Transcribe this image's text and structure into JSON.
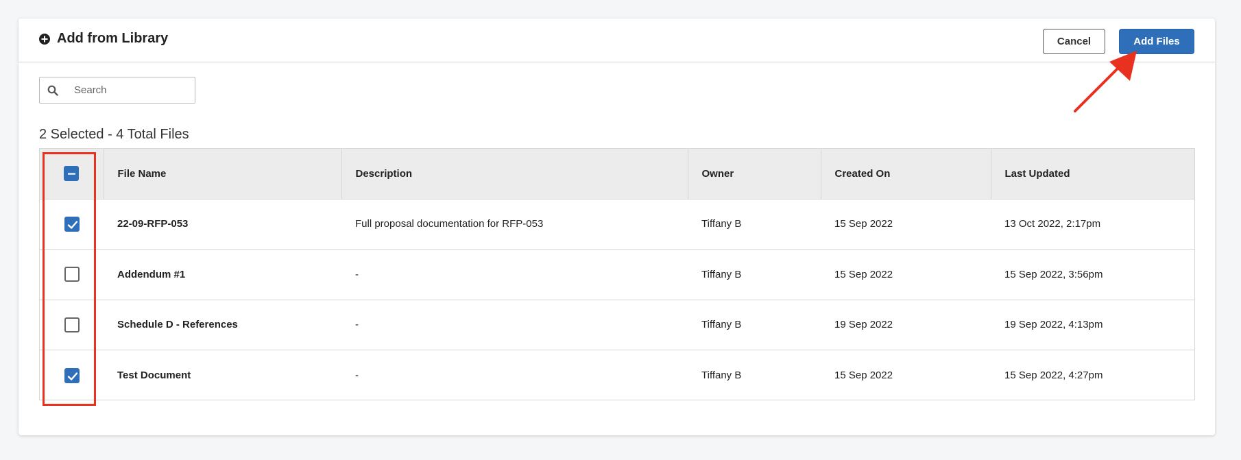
{
  "header": {
    "title": "Add from Library",
    "title_icon": "plus-circle-icon",
    "cancel_label": "Cancel",
    "add_label": "Add Files"
  },
  "search": {
    "placeholder": "Search",
    "value": ""
  },
  "summary": "2 Selected - 4 Total Files",
  "table": {
    "columns": [
      "File Name",
      "Description",
      "Owner",
      "Created On",
      "Last Updated"
    ],
    "select_all_state": "indeterminate",
    "rows": [
      {
        "checked": true,
        "file_name": "22-09-RFP-053",
        "description": "Full proposal documentation for RFP-053",
        "owner": "Tiffany B",
        "created_on": "15 Sep 2022",
        "last_updated": "13 Oct 2022, 2:17pm"
      },
      {
        "checked": false,
        "file_name": "Addendum #1",
        "description": "-",
        "owner": "Tiffany B",
        "created_on": "15 Sep 2022",
        "last_updated": "15 Sep 2022, 3:56pm"
      },
      {
        "checked": false,
        "file_name": "Schedule D - References",
        "description": "-",
        "owner": "Tiffany B",
        "created_on": "19 Sep 2022",
        "last_updated": "19 Sep 2022, 4:13pm"
      },
      {
        "checked": true,
        "file_name": "Test Document",
        "description": "-",
        "owner": "Tiffany B",
        "created_on": "15 Sep 2022",
        "last_updated": "15 Sep 2022, 4:27pm"
      }
    ]
  },
  "colors": {
    "accent": "#2f6fba",
    "annotation": "#e8321f"
  }
}
